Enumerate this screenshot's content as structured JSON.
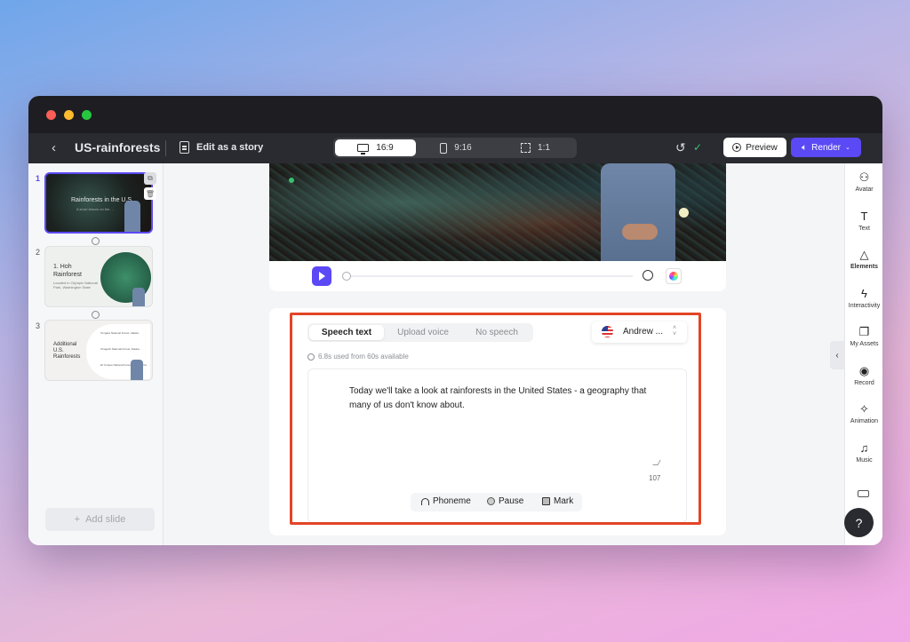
{
  "window": {
    "title_controls": [
      "close",
      "minimize",
      "maximize"
    ]
  },
  "toolbar": {
    "back_icon": "chevron-left-icon",
    "project_title": "US-rainforests",
    "story_label": "Edit as a story",
    "ratios": [
      {
        "label": "16:9",
        "icon": "monitor-icon",
        "active": true
      },
      {
        "label": "9:16",
        "icon": "phone-icon",
        "active": false
      },
      {
        "label": "1:1",
        "icon": "square-icon",
        "active": false
      }
    ],
    "preview_label": "Preview",
    "render_label": "Render",
    "render_color": "#5b49f5"
  },
  "slides": {
    "items": [
      {
        "number": "1",
        "title": "Rainforests in the U.S.",
        "subtitle": "A short lesson on the ...",
        "active": true
      },
      {
        "number": "2",
        "title": "1. Hoh Rainforest",
        "subtitle": "Located in Olympic National Park, Washington State",
        "active": false
      },
      {
        "number": "3",
        "title": "Additional U.S. Rainforests",
        "bullets": [
          "Tongass National Forest, Alaska",
          "Chugach National Forest, Alaska",
          "El Yunque National Forest, Puerto Rico"
        ],
        "active": false
      }
    ],
    "add_label": "Add slide"
  },
  "speech": {
    "tabs": [
      "Speech text",
      "Upload voice",
      "No speech"
    ],
    "active_tab": "Speech text",
    "voice": "Andrew ...",
    "usage": "6.8s used from 60s available",
    "script_line1": "Today we'll take a look at rainforests in the United States - a geography that",
    "script_line2": "many of us don't know about.",
    "char_count": "107",
    "chips": [
      "Phoneme",
      "Pause",
      "Mark"
    ]
  },
  "rightbar": {
    "tools": [
      {
        "label": "Avatar",
        "icon": "person-icon"
      },
      {
        "label": "Text",
        "icon": "text-icon"
      },
      {
        "label": "Elements",
        "icon": "shapes-icon",
        "active": true
      },
      {
        "label": "Interactivity",
        "icon": "bolt-icon"
      },
      {
        "label": "My Assets",
        "icon": "assets-icon"
      },
      {
        "label": "Record",
        "icon": "record-icon"
      },
      {
        "label": "Animation",
        "icon": "sparkle-icon"
      },
      {
        "label": "Music",
        "icon": "music-icon"
      }
    ],
    "help_label": "?"
  }
}
